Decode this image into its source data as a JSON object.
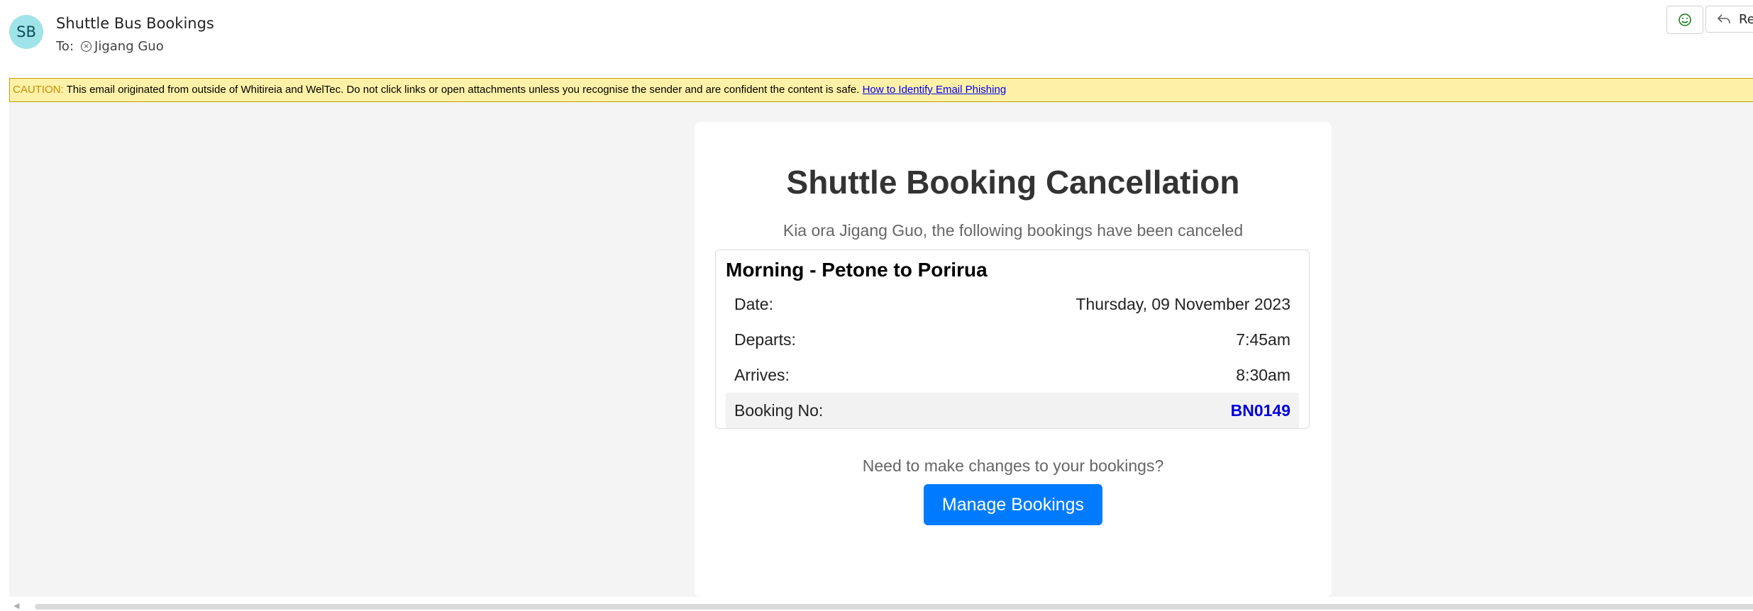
{
  "header": {
    "avatar_initials": "SB",
    "sender_name": "Shuttle Bus Bookings",
    "to_label": "To:",
    "recipient": "Jigang Guo",
    "reply_label": "Re"
  },
  "caution": {
    "tag": "CAUTION:",
    "message": " This email originated from outside of Whitireia and WelTec. Do not click links or open attachments unless you recognise the sender and are confident the content is safe. ",
    "link_text": "How to Identify Email Phishing"
  },
  "email": {
    "title": "Shuttle Booking Cancellation",
    "greeting": "Kia ora Jigang Guo, the following bookings have been canceled",
    "booking": {
      "trip_title": "Morning - Petone to Porirua",
      "rows": [
        {
          "label": "Date:",
          "value": "Thursday, 09 November 2023"
        },
        {
          "label": "Departs:",
          "value": "7:45am"
        },
        {
          "label": "Arrives:",
          "value": "8:30am"
        },
        {
          "label": "Booking No:",
          "value": "BN0149"
        }
      ]
    },
    "changes_prompt": "Need to make changes to your bookings?",
    "manage_button": "Manage Bookings"
  },
  "colors": {
    "accent_button": "#007bff",
    "booking_number": "#0000dd",
    "caution_background": "#fff2a8",
    "avatar_background": "#9fe4e9"
  },
  "icons": {
    "emoji": "smiley-icon",
    "reply": "reply-arrow-icon",
    "recipient": "person-circle-icon"
  }
}
